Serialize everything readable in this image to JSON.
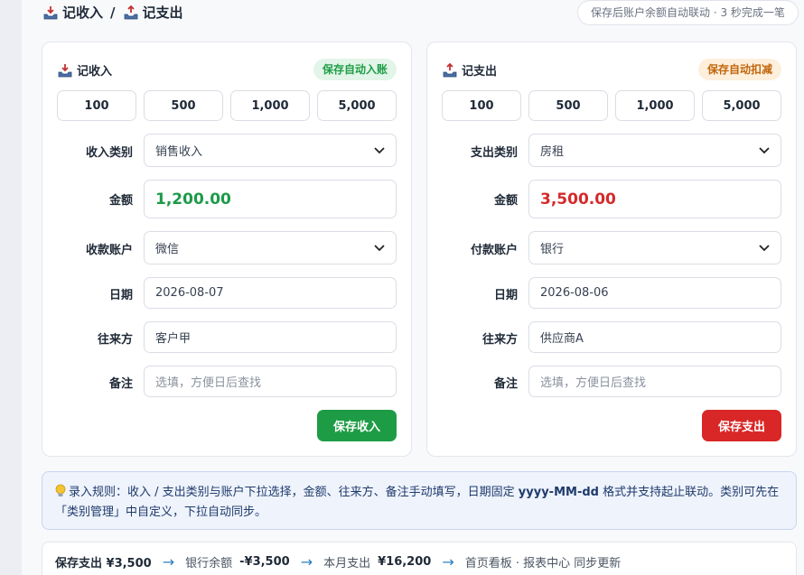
{
  "header": {
    "title_income": "记收入",
    "separator": "/",
    "title_expense": "记支出",
    "note": "保存后账户余额自动联动 · 3 秒完成一笔"
  },
  "income": {
    "title": "记收入",
    "badge": "保存自动入账",
    "quick_amounts": [
      "100",
      "500",
      "1,000",
      "5,000"
    ],
    "category_label": "收入类别",
    "category_value": "销售收入",
    "amount_label": "金额",
    "amount_value": "1,200.00",
    "account_label": "收款账户",
    "account_value": "微信",
    "date_label": "日期",
    "date_value": "2026-08-07",
    "party_label": "往来方",
    "party_value": "客户甲",
    "note_label": "备注",
    "note_placeholder": "选填，方便日后查找",
    "save_label": "保存收入"
  },
  "expense": {
    "title": "记支出",
    "badge": "保存自动扣减",
    "quick_amounts": [
      "100",
      "500",
      "1,000",
      "5,000"
    ],
    "category_label": "支出类别",
    "category_value": "房租",
    "amount_label": "金额",
    "amount_value": "3,500.00",
    "account_label": "付款账户",
    "account_value": "银行",
    "date_label": "日期",
    "date_value": "2026-08-06",
    "party_label": "往来方",
    "party_value": "供应商A",
    "note_label": "备注",
    "note_placeholder": "选填，方便日后查找",
    "save_label": "保存支出"
  },
  "rule": {
    "text_1": "录入规则：收入 / 支出类别与账户下拉选择，金额、往来方、备注手动填写，日期固定 ",
    "date_format": "yyyy-MM-dd",
    "text_2": " 格式并支持起止联动。类别可先在「类别管理」中自定义，下拉自动同步。"
  },
  "flow": {
    "step1": "保存支出 ¥3,500",
    "step2_label": "银行余额",
    "step2_value": "-¥3,500",
    "step3_label": "本月支出",
    "step3_value": "¥16,200",
    "step4": "首页看板 · 报表中心 同步更新"
  },
  "colors": {
    "income_accent": "#1e9c45",
    "expense_accent": "#d92626",
    "badge_orange": "#c2650a",
    "flow_arrow": "#2a7fc0"
  }
}
